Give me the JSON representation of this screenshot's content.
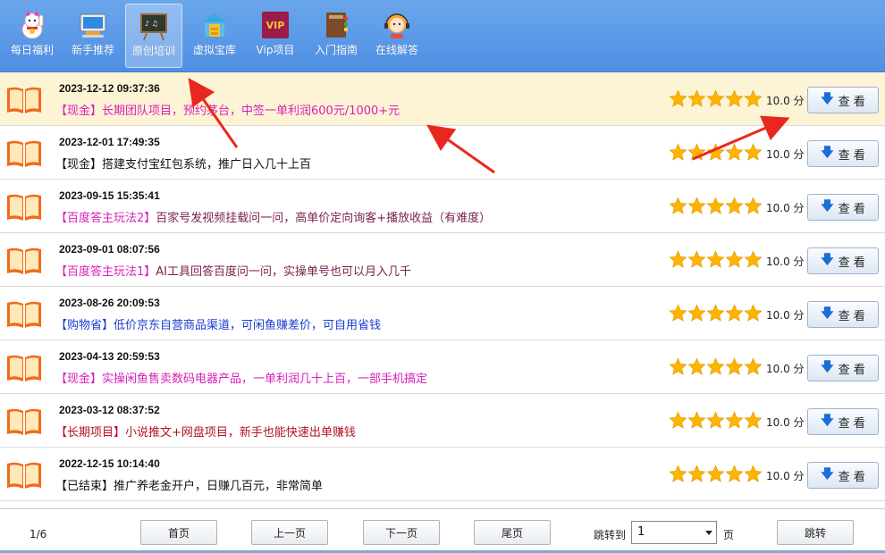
{
  "toolbar": {
    "items": [
      {
        "label": "每日福利",
        "icon": "lucky-cat-icon"
      },
      {
        "label": "新手推荐",
        "icon": "monitor-icon"
      },
      {
        "label": "原创培训",
        "icon": "blackboard-icon",
        "active": true
      },
      {
        "label": "虚拟宝库",
        "icon": "treasure-icon"
      },
      {
        "label": "Vip项目",
        "icon": "vip-icon",
        "badge": "VIP"
      },
      {
        "label": "入门指南",
        "icon": "book-stack-icon"
      },
      {
        "label": "在线解答",
        "icon": "support-agent-icon"
      }
    ]
  },
  "list": {
    "rows": [
      {
        "date": "2023-12-12 09:37:36",
        "title": "【现金】长期团队项目，预约茅台，中签一单利润600元/1000+元",
        "color": "#d81fb8",
        "score": "10.0 分",
        "button": "查 看",
        "highlight": true
      },
      {
        "date": "2023-12-01 17:49:35",
        "title": "【现金】搭建支付宝红包系统，推广日入几十上百",
        "color": "#111111",
        "score": "10.0 分",
        "button": "查 看"
      },
      {
        "date": "2023-09-15 15:35:41",
        "title": "【百度答主玩法2】百家号发视频挂载问一问，高单价定向询客+播放收益（有难度）",
        "color": "#7a1f4e",
        "score": "10.0 分",
        "button": "查 看",
        "prefix_color": "#d81fb8"
      },
      {
        "date": "2023-09-01 08:07:56",
        "title": "【百度答主玩法1】AI工具回答百度问一问，实操单号也可以月入几千",
        "color": "#7a1f4e",
        "score": "10.0 分",
        "button": "查 看",
        "prefix_color": "#d81fb8"
      },
      {
        "date": "2023-08-26 20:09:53",
        "title": "【购物省】低价京东自营商品渠道，可闲鱼赚差价，可自用省钱",
        "color": "#1a3ccf",
        "score": "10.0 分",
        "button": "查 看"
      },
      {
        "date": "2023-04-13 20:59:53",
        "title": "【现金】实操闲鱼售卖数码电器产品，一单利润几十上百，一部手机搞定",
        "color": "#d81fb8",
        "score": "10.0 分",
        "button": "查 看"
      },
      {
        "date": "2023-03-12 08:37:52",
        "title": "【长期项目】小说推文+网盘项目，新手也能快速出单赚钱",
        "color": "#b3121f",
        "score": "10.0 分",
        "button": "查 看"
      },
      {
        "date": "2022-12-15 10:14:40",
        "title": "【已结束】推广养老金开户，日赚几百元，非常简单",
        "color": "#111111",
        "score": "10.0 分",
        "button": "查 看"
      }
    ],
    "rating": 5
  },
  "pager": {
    "info": "1/6",
    "first": "首页",
    "prev": "上一页",
    "next": "下一页",
    "last": "尾页",
    "jump_label": "跳转到",
    "jump_value": "1",
    "page_unit": "页",
    "jump_button": "跳转"
  },
  "colors": {
    "toolbar": "#5b9be8",
    "highlight_row": "#fdf4d5",
    "star": "#ffb400",
    "arrow": "#e8281e"
  }
}
